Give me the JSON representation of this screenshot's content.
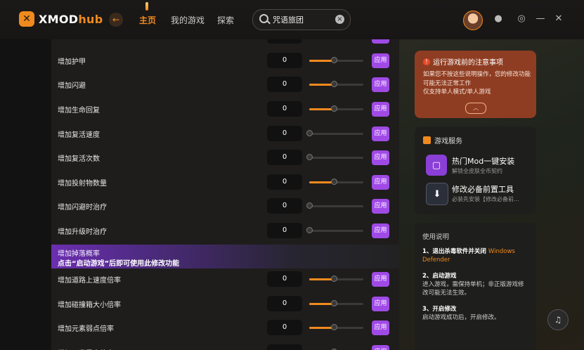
{
  "app": {
    "logo_main": "XMOD",
    "logo_accent": "hub",
    "logo_mark": "✕"
  },
  "nav": {
    "back_icon": "←",
    "items": [
      {
        "label": "主页",
        "active": true
      },
      {
        "label": "我的游戏",
        "active": false
      },
      {
        "label": "探索",
        "active": false
      }
    ]
  },
  "search": {
    "value": "咒语旅团",
    "clear_icon": "×"
  },
  "top_icons": [
    "settings-icon",
    "target-icon",
    "minimize-icon",
    "close-icon"
  ],
  "top_icon_glyphs": [
    "●",
    "◎",
    "—",
    "✕"
  ],
  "rows": [
    {
      "label": "",
      "value": "",
      "apply": "应用",
      "fill": 0.45,
      "partial": true
    },
    {
      "label": "增加护甲",
      "value": "0",
      "apply": "应用",
      "fill": 0.45
    },
    {
      "label": "增加闪避",
      "value": "0",
      "apply": "应用",
      "fill": 0.45
    },
    {
      "label": "增加生命回复",
      "value": "0",
      "apply": "应用",
      "fill": 0.45
    },
    {
      "label": "增加复活速度",
      "value": "0",
      "apply": "应用",
      "fill": 0.0
    },
    {
      "label": "增加复活次数",
      "value": "0",
      "apply": "应用",
      "fill": 0.0
    },
    {
      "label": "增加投射物数量",
      "value": "0",
      "apply": "应用",
      "fill": 0.45
    },
    {
      "label": "增加闪避时治疗",
      "value": "0",
      "apply": "应用",
      "fill": 0.0
    },
    {
      "label": "增加升级时治疗",
      "value": "0",
      "apply": "应用",
      "fill": 0.0
    },
    {
      "label": "",
      "value": "",
      "apply": "",
      "fill": 0,
      "locked": true
    },
    {
      "label": "增加道路上速度倍率",
      "value": "0",
      "apply": "应用",
      "fill": 0.45
    },
    {
      "label": "增加碰撞箱大小倍率",
      "value": "0",
      "apply": "应用",
      "fill": 0.45
    },
    {
      "label": "增加元素弱点倍率",
      "value": "0",
      "apply": "应用",
      "fill": 0.45
    },
    {
      "label": "增加元素暴击倍率",
      "value": "",
      "apply": "应用",
      "fill": 0.45,
      "partial": true
    }
  ],
  "locked_row": {
    "title": "增加掉落概率",
    "note": "点击“启动游戏”后即可使用此修改功能"
  },
  "notice": {
    "title": "运行游戏前的注意事项",
    "icon": "!",
    "text": "如果您不按这些说明操作，您的修改功能可能无法正常工作",
    "text2": "仅支持单人模式/单人游戏",
    "button": "︿"
  },
  "service": {
    "title": "游戏服务",
    "items": [
      {
        "name": "热门Mod一键安装",
        "sub": "解锁全皮肤全币契约",
        "icon": "▢",
        "color": "#8a3fd6"
      },
      {
        "name": "修改必备前置工具",
        "sub": "必装先安装【修改必备前...",
        "icon": "⬇",
        "color": "#2a2f3a"
      }
    ]
  },
  "usage": {
    "title": "使用说明",
    "steps": [
      {
        "head": "1、退出杀毒软件并关闭",
        "accent": "Windows Defender",
        "body": ""
      },
      {
        "head": "2、启动游戏",
        "accent": "",
        "body": "进入游戏，需保持单机；非正版游戏修改可能无法生效。"
      },
      {
        "head": "3、开启修改",
        "accent": "",
        "body": "启动游戏成功后，开启修改。"
      }
    ]
  },
  "help_icon": "♫"
}
